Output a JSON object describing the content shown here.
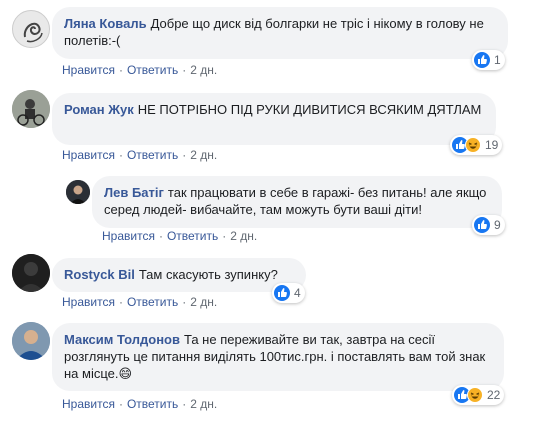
{
  "comments": [
    {
      "author": "Ляна Коваль",
      "text": "Добре що диск від болгарки не тріс і нікому в голову не полетів:-(",
      "like_label": "Нравится",
      "reply_label": "Ответить",
      "time": "2 дн.",
      "reaction_count": "1",
      "reactions": [
        "like-icon"
      ],
      "avatar_icon": "curl-logo-avatar"
    },
    {
      "author": "Роман Жук",
      "text": "НЕ ПОТРІБНО ПІД РУКИ ДИВИТИСЯ ВСЯКИМ ДЯТЛАМ",
      "like_label": "Нравится",
      "reply_label": "Ответить",
      "time": "2 дн.",
      "reaction_count": "19",
      "reactions": [
        "like-icon",
        "haha-icon"
      ],
      "avatar_icon": "person-photo-avatar"
    },
    {
      "author": "Лев Батіг",
      "text": "так працювати в себе в гаражі- без питань! але якщо серед людей- вибачайте, там можуть бути ваші діти!",
      "like_label": "Нравится",
      "reply_label": "Ответить",
      "time": "2 дн.",
      "reaction_count": "9",
      "reactions": [
        "like-icon"
      ],
      "avatar_icon": "person-photo-avatar"
    },
    {
      "author": "Rostyck Bil",
      "text": "Там скасують зупинку?",
      "like_label": "Нравится",
      "reply_label": "Ответить",
      "time": "2 дн.",
      "reaction_count": "4",
      "reactions": [
        "like-icon"
      ],
      "avatar_icon": "dark-silhouette-avatar"
    },
    {
      "author": "Максим Толдонов",
      "text": "Та не переживайте ви так, завтра на сесії розглянуть це питання виділять 100тис.грн. і поставлять вам той знак на місце.",
      "emoji": "😄",
      "like_label": "Нравится",
      "reply_label": "Ответить",
      "time": "2 дн.",
      "reaction_count": "22",
      "reactions": [
        "like-icon",
        "haha-icon"
      ],
      "avatar_icon": "person-photo-avatar"
    }
  ],
  "colors": {
    "author": "#385898",
    "bubble": "#f2f3f5",
    "like": "#1877f2",
    "haha": "#f7b125"
  }
}
